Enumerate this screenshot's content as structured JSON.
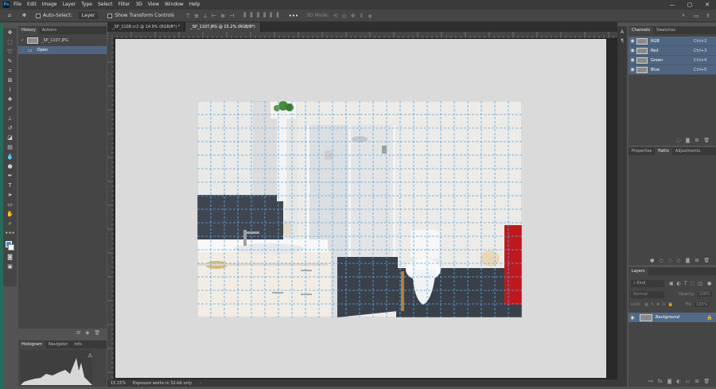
{
  "app": {
    "logo": "Ps",
    "menu": [
      "File",
      "Edit",
      "Image",
      "Layer",
      "Type",
      "Select",
      "Filter",
      "3D",
      "View",
      "Window",
      "Help"
    ]
  },
  "options_bar": {
    "auto_select_label": "Auto-Select:",
    "auto_select_value": "Layer",
    "transform_controls_label": "Show Transform Controls",
    "mode_3d_label": "3D Mode:"
  },
  "document_tabs": [
    {
      "label": "_SP_1108.cr2 @ 14.9% (RGB/8*) *",
      "active": false
    },
    {
      "label": "_SP_1107.JPG @ 15.2% (RGB/8*)",
      "active": true
    }
  ],
  "history_panel": {
    "tabs": [
      "History",
      "Actions"
    ],
    "snapshot_label": "_SP_1107.JPG",
    "items": [
      "Open"
    ]
  },
  "histogram_panel": {
    "tabs": [
      "Histogram",
      "Navigator",
      "Info"
    ]
  },
  "status_bar": {
    "zoom": "15.15%",
    "message": "Exposure works in 32-bit only"
  },
  "channels_panel": {
    "tabs": [
      "Channels",
      "Swatches"
    ],
    "channels": [
      {
        "name": "RGB",
        "shortcut": "Ctrl+2"
      },
      {
        "name": "Red",
        "shortcut": "Ctrl+3"
      },
      {
        "name": "Green",
        "shortcut": "Ctrl+4"
      },
      {
        "name": "Blue",
        "shortcut": "Ctrl+5"
      }
    ]
  },
  "properties_panel": {
    "tabs": [
      "Properties",
      "Paths",
      "Adjustments"
    ]
  },
  "layers_panel": {
    "title": "Layers",
    "kind_placeholder": "Kind",
    "blend_mode": "Normal",
    "opacity_label": "Opacity:",
    "opacity_value": "100%",
    "lock_label": "Lock:",
    "fill_label": "Fill:",
    "fill_value": "100%",
    "layers": [
      {
        "name": "Background"
      }
    ]
  }
}
